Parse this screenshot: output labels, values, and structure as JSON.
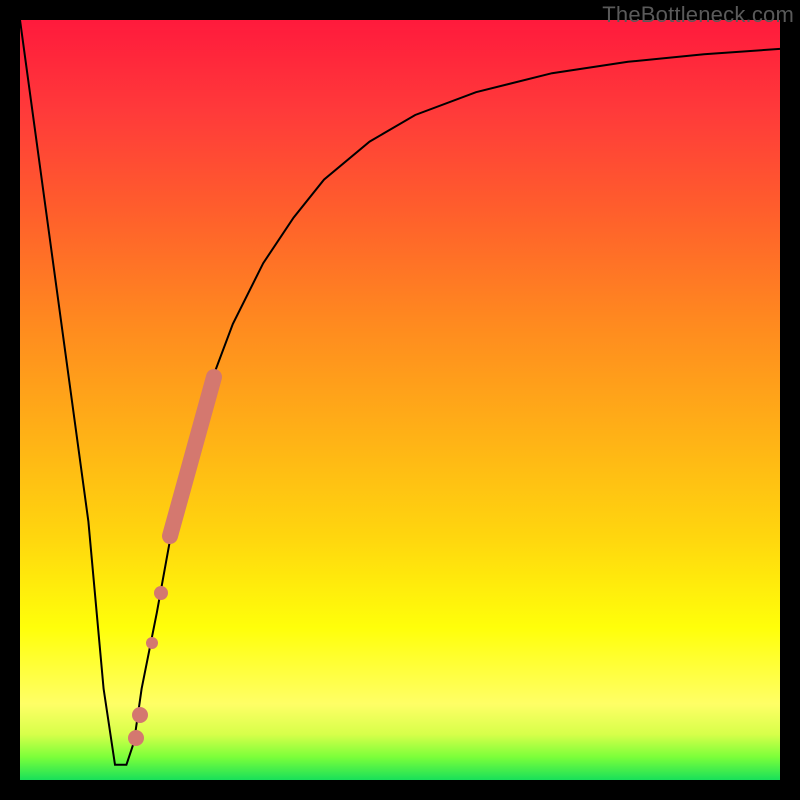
{
  "watermark": "TheBottleneck.com",
  "chart_data": {
    "type": "line",
    "title": "",
    "xlabel": "",
    "ylabel": "",
    "xlim": [
      0,
      100
    ],
    "ylim": [
      0,
      100
    ],
    "grid": false,
    "series": [
      {
        "name": "bottleneck-curve",
        "x": [
          0,
          3,
          6,
          9,
          11,
          12.5,
          14,
          15,
          16,
          18,
          20,
          22,
          25,
          28,
          32,
          36,
          40,
          46,
          52,
          60,
          70,
          80,
          90,
          100
        ],
        "values": [
          100,
          78,
          56,
          34,
          12,
          2,
          2,
          5,
          12,
          22,
          33,
          42,
          52,
          60,
          68,
          74,
          79,
          84,
          87.5,
          90.5,
          93,
          94.5,
          95.5,
          96.2
        ]
      }
    ],
    "markers": [
      {
        "name": "sweet-spot-dot-1",
        "x": 15.2,
        "y": 5.5
      },
      {
        "name": "sweet-spot-dot-2",
        "x": 15.8,
        "y": 8.5
      },
      {
        "name": "dot-mid-1",
        "x": 17.4,
        "y": 18
      },
      {
        "name": "dot-mid-2",
        "x": 18.5,
        "y": 24.5
      },
      {
        "name": "thick-segment-start",
        "x": 19.8,
        "y": 32
      },
      {
        "name": "thick-segment-end",
        "x": 25.5,
        "y": 53
      }
    ],
    "colors": {
      "curve": "#000000",
      "markers": "#d4786f",
      "gradient_top": "#ff1a3c",
      "gradient_bottom": "#18e05a"
    }
  }
}
